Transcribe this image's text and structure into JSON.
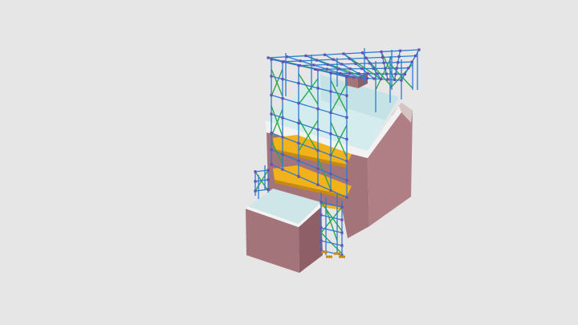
{
  "viewer": {
    "background": "#e6e6e6",
    "model_colors": {
      "brick_wall": "#b07f86",
      "brick_wall_dark": "#9a6b72",
      "brick_wall_shadow": "#8d5f67",
      "roof_glass": "#d8eef0",
      "roof_glass_shadow": "#bfdadd",
      "white_ledge": "#f4f4f4",
      "scaffold_tube": "#2c7bd0",
      "scaffold_brace": "#2ba84a",
      "scaffold_coupler": "#6a4fb0",
      "scaffold_deck": "#f2b21c",
      "scaffold_deck_edge": "#c78a10"
    }
  }
}
